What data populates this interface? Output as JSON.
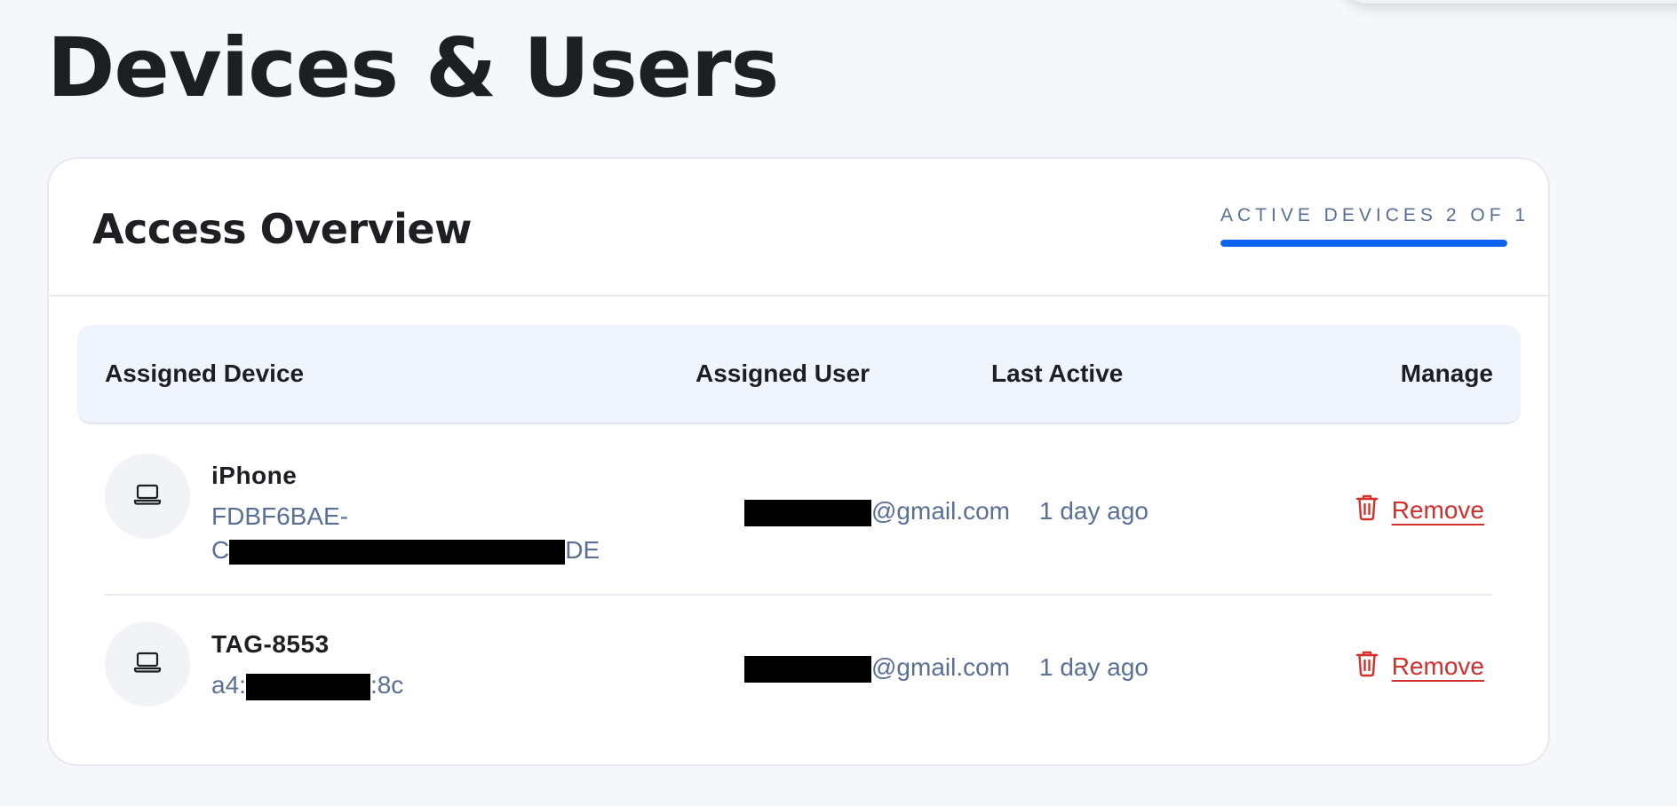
{
  "page": {
    "title": "Devices & Users"
  },
  "overview": {
    "title": "Access Overview",
    "quota_label": "ACTIVE DEVICES",
    "quota_value": "2 OF 1",
    "quota_fill": 1.0,
    "quota_color": "#0b63f0"
  },
  "table": {
    "headers": {
      "device": "Assigned Device",
      "user": "Assigned User",
      "last_active": "Last Active",
      "manage": "Manage"
    },
    "rows": [
      {
        "device_name": "iPhone",
        "device_id_line1": "FDBF6BAE-",
        "device_id_line2_prefix": "C",
        "device_id_line2_suffix": "DE",
        "user_suffix": "@gmail.com",
        "last_active": "1 day ago",
        "action": "Remove",
        "icon": "laptop-icon"
      },
      {
        "device_name": "TAG-8553",
        "device_id_prefix": "a4:",
        "device_id_suffix": ":8c",
        "user_suffix": "@gmail.com",
        "last_active": "1 day ago",
        "action": "Remove",
        "icon": "laptop-icon"
      }
    ]
  },
  "colors": {
    "accent": "#0b63f0",
    "danger": "#d3302b",
    "muted_text": "#5a6f95"
  }
}
